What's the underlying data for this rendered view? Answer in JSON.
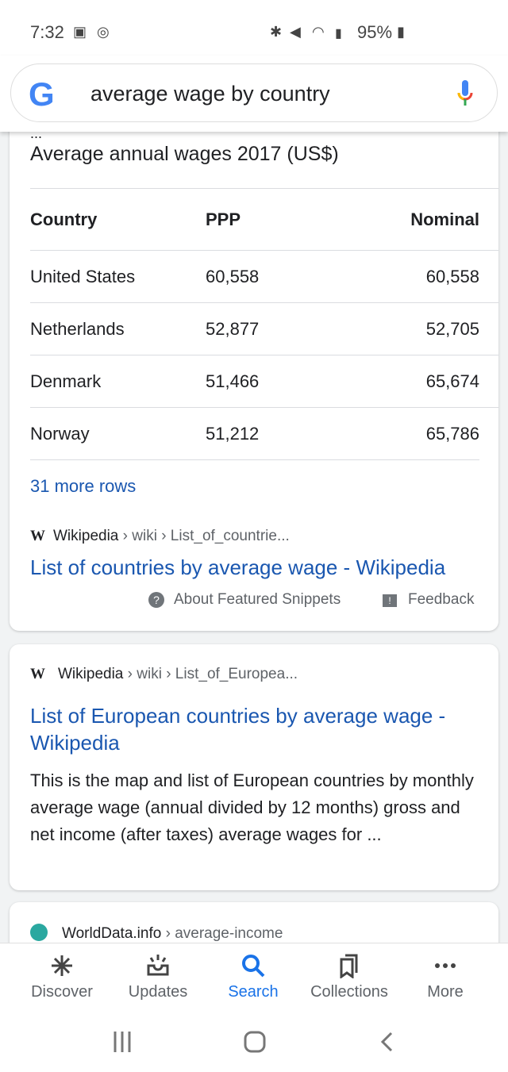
{
  "status_bar": {
    "time": "7:32",
    "battery": "95%",
    "icons": [
      "cast-icon",
      "instagram-icon",
      "bluetooth-icon",
      "mute-icon",
      "wifi-icon",
      "signal-icon",
      "battery-charging-icon"
    ]
  },
  "search": {
    "query": "average wage by country"
  },
  "snippet": {
    "ellipsis": "...",
    "title": "Average annual wages 2017 (US$)",
    "columns": [
      "Country",
      "PPP",
      "Nominal"
    ],
    "rows": [
      [
        "United States",
        "60,558",
        "60,558"
      ],
      [
        "Netherlands",
        "52,877",
        "52,705"
      ],
      [
        "Denmark",
        "51,466",
        "65,674"
      ],
      [
        "Norway",
        "51,212",
        "65,786"
      ]
    ],
    "more_rows": "31 more rows",
    "source_site": "Wikipedia",
    "source_path": " › wiki › List_of_countrie...",
    "link": "List of countries by average wage - Wikipedia",
    "about": "About Featured Snippets",
    "feedback": "Feedback"
  },
  "result2": {
    "source_site": "Wikipedia",
    "source_path": " › wiki › List_of_Europea...",
    "link": "List of European countries by average wage - Wikipedia",
    "snippet": "This is the map and list of European countries by monthly average wage (annual divided by 12 months) gross and net income (after taxes) average wages for ..."
  },
  "result3": {
    "source_site": "WorldData.info",
    "source_path": " › average-income"
  },
  "bottom_nav": {
    "items": [
      {
        "label": "Discover"
      },
      {
        "label": "Updates"
      },
      {
        "label": "Search",
        "active": true
      },
      {
        "label": "Collections"
      },
      {
        "label": "More"
      }
    ]
  },
  "colors": {
    "link": "#1a57b0",
    "active_nav": "#1a73e8"
  }
}
